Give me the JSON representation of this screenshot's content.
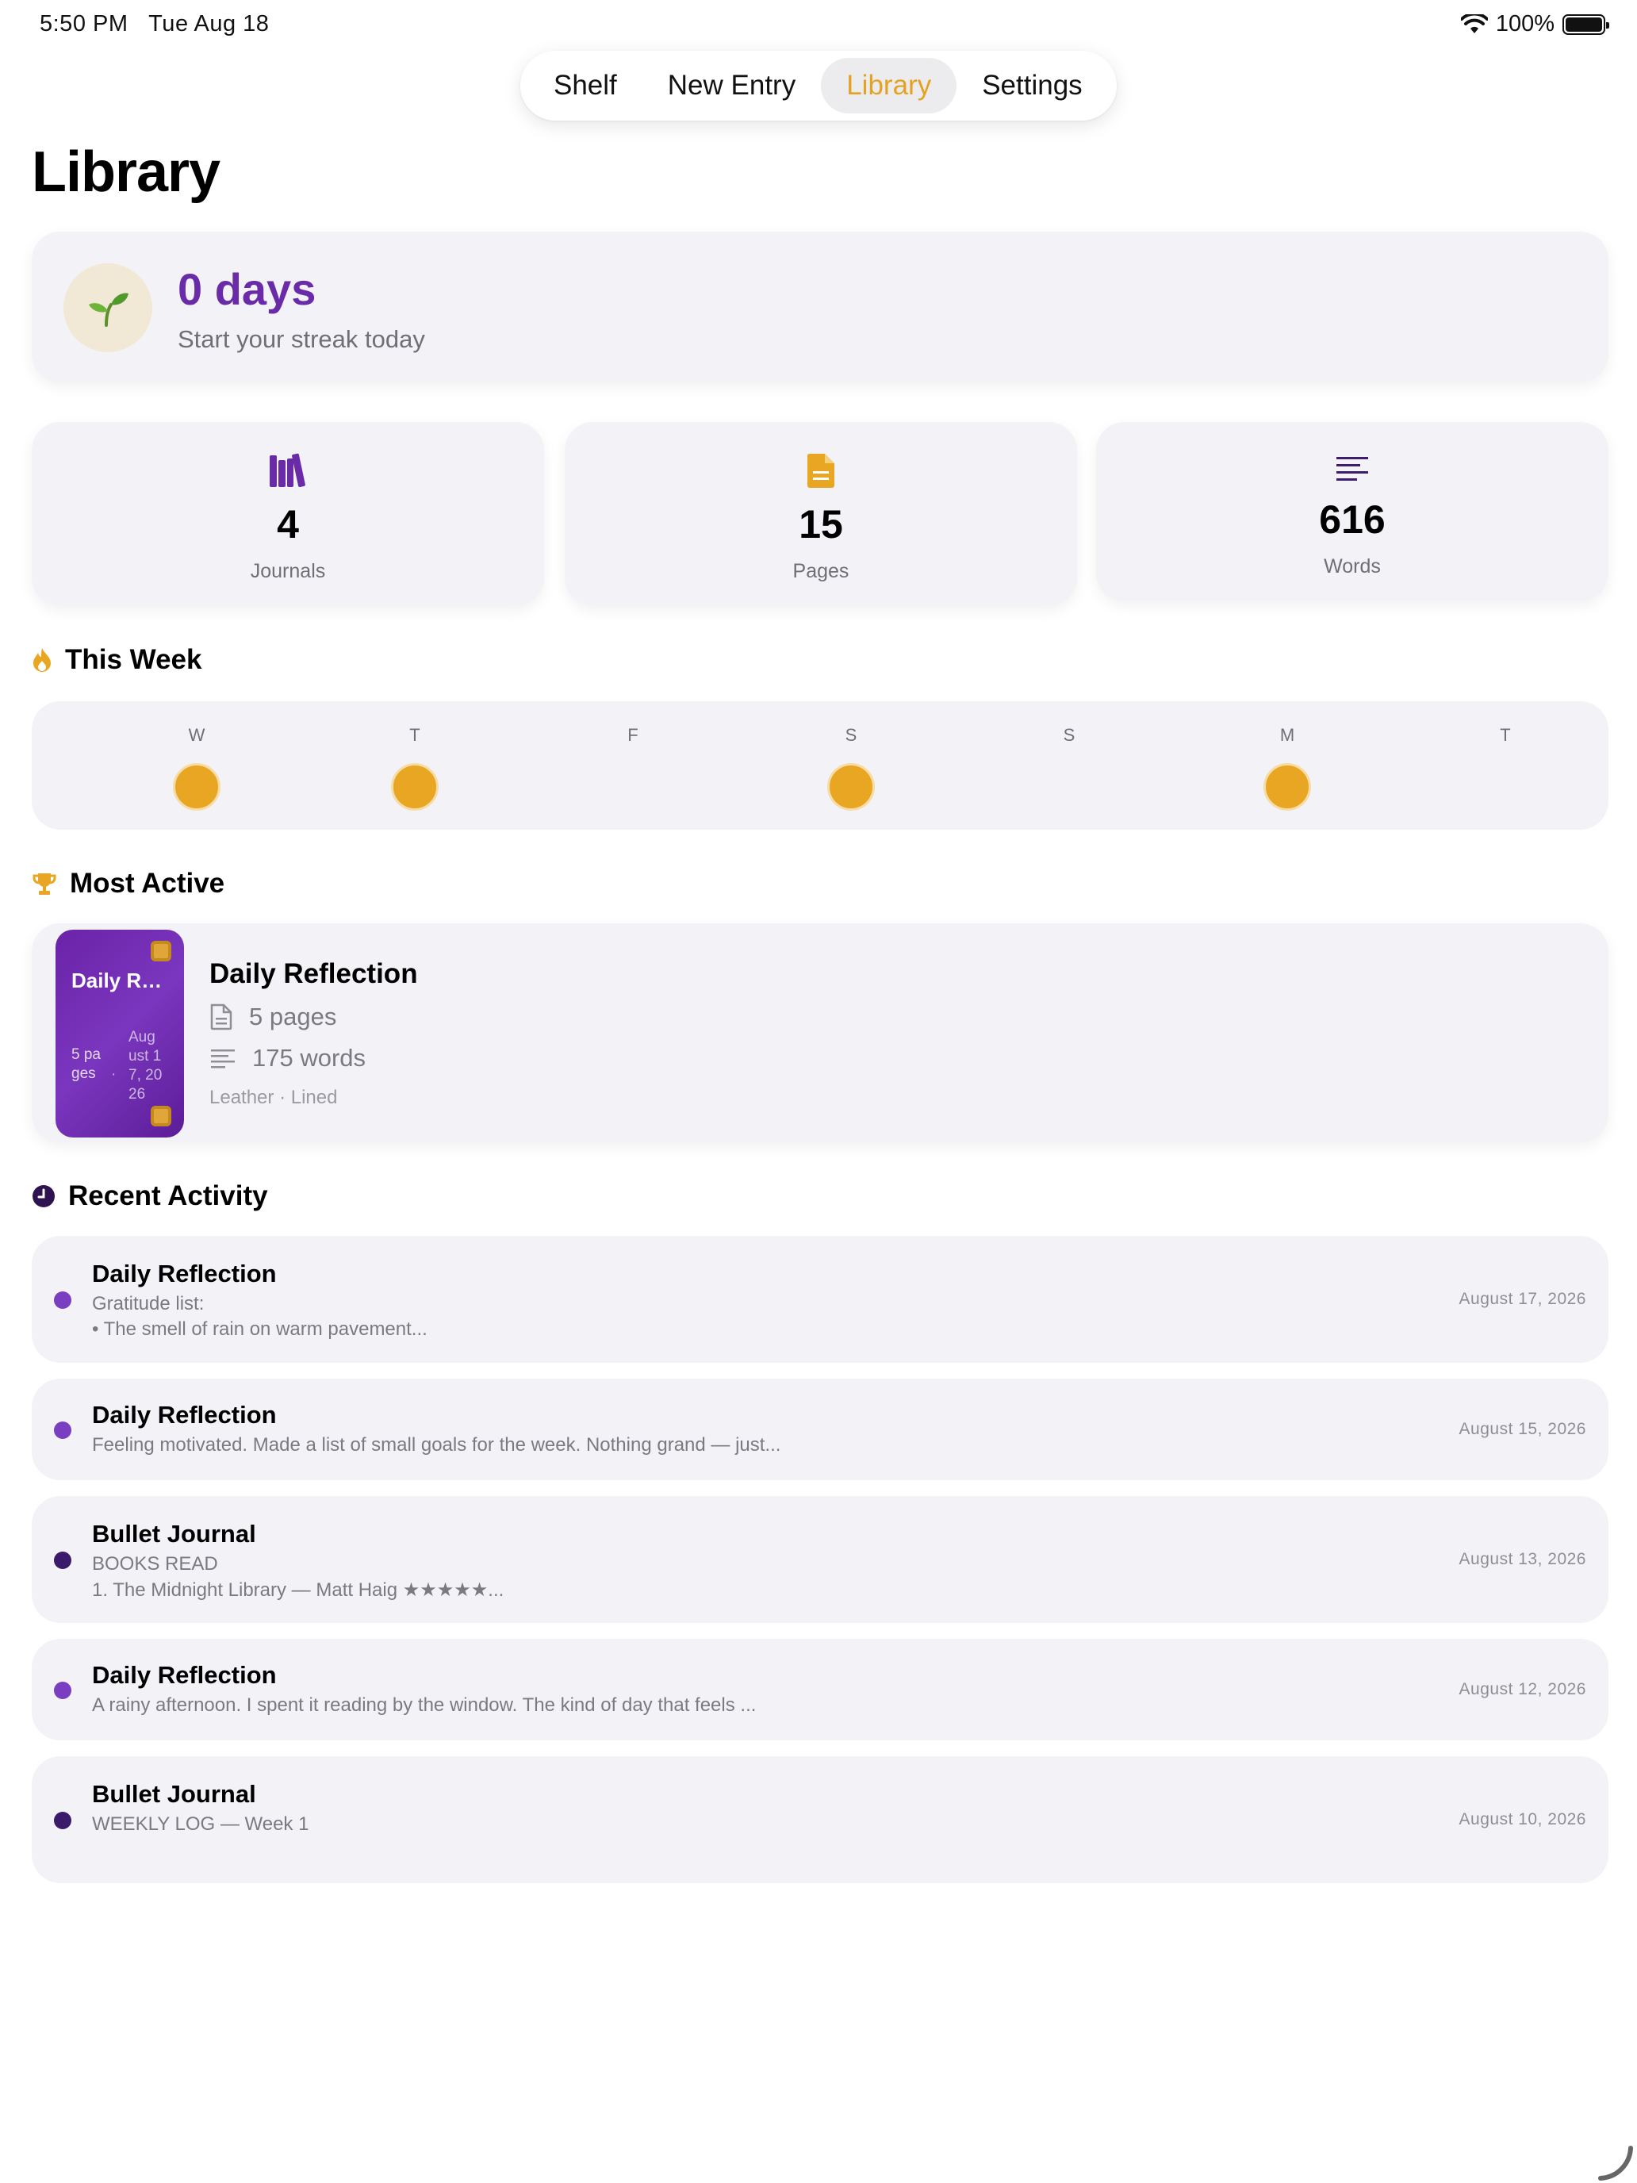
{
  "status": {
    "time": "5:50 PM",
    "date": "Tue Aug 18",
    "battery": "100%"
  },
  "tabs": [
    {
      "label": "Shelf"
    },
    {
      "label": "New Entry"
    },
    {
      "label": "Library",
      "active": true
    },
    {
      "label": "Settings"
    }
  ],
  "page": {
    "title": "Library"
  },
  "streak": {
    "value": "0 days",
    "subtitle": "Start your streak today",
    "icon": "seedling-icon"
  },
  "stats": [
    {
      "value": "4",
      "label": "Journals",
      "icon": "books-icon",
      "color": "#6a2ba8"
    },
    {
      "value": "15",
      "label": "Pages",
      "icon": "document-icon",
      "color": "#e8a622"
    },
    {
      "value": "616",
      "label": "Words",
      "icon": "text-lines-icon",
      "color": "#3f1d6e"
    }
  ],
  "week": {
    "title": "This Week",
    "days": [
      {
        "letter": "W",
        "active": true
      },
      {
        "letter": "T",
        "active": true
      },
      {
        "letter": "F",
        "active": false
      },
      {
        "letter": "S",
        "active": true
      },
      {
        "letter": "S",
        "active": false
      },
      {
        "letter": "M",
        "active": true
      },
      {
        "letter": "T",
        "active": false
      }
    ]
  },
  "most_active": {
    "title": "Most Active",
    "journal": {
      "cover_title": "Daily Reflecti...",
      "cover_pages": "5 pages",
      "cover_date": "August 17, 2026",
      "name": "Daily Reflection",
      "pages": "5 pages",
      "words": "175 words",
      "meta": "Leather · Lined"
    }
  },
  "recent": {
    "title": "Recent Activity",
    "items": [
      {
        "title": "Daily Reflection",
        "lines": [
          "Gratitude list:",
          "• The smell of rain on warm pavement..."
        ],
        "date": "August 17, 2026",
        "color": "#7a3fc0"
      },
      {
        "title": "Daily Reflection",
        "lines": [
          "Feeling motivated. Made a list of small goals for the week. Nothing grand — just..."
        ],
        "date": "August 15, 2026",
        "color": "#7a3fc0"
      },
      {
        "title": "Bullet Journal",
        "lines": [
          "BOOKS READ",
          "1. The Midnight Library — Matt Haig ★★★★★..."
        ],
        "date": "August 13, 2026",
        "color": "#3b1a6b"
      },
      {
        "title": "Daily Reflection",
        "lines": [
          "A rainy afternoon. I spent it reading by the window. The kind of day that feels ..."
        ],
        "date": "August 12, 2026",
        "color": "#7a3fc0"
      },
      {
        "title": "Bullet Journal",
        "lines": [
          "WEEKLY LOG — Week 1"
        ],
        "date": "August 10, 2026",
        "color": "#3b1a6b"
      }
    ]
  }
}
